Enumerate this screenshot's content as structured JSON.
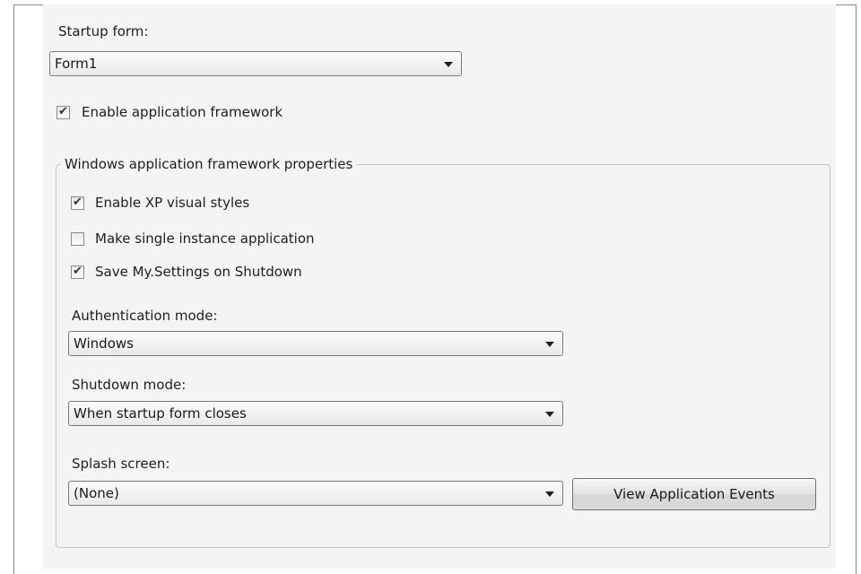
{
  "startup": {
    "label": "Startup form:",
    "value": "Form1"
  },
  "enable_framework": {
    "label": "Enable application framework",
    "checked": true
  },
  "framework_group": {
    "title": "Windows application framework properties",
    "xp_styles": {
      "label": "Enable XP visual styles",
      "checked": true
    },
    "single_instance": {
      "label": "Make single instance application",
      "checked": false
    },
    "save_settings": {
      "label": "Save My.Settings on Shutdown",
      "checked": true
    },
    "authentication": {
      "label": "Authentication mode:",
      "value": "Windows"
    },
    "shutdown": {
      "label": "Shutdown mode:",
      "value": "When startup form closes"
    },
    "splash": {
      "label": "Splash screen:",
      "value": "(None)"
    },
    "view_events_label": "View Application Events"
  }
}
